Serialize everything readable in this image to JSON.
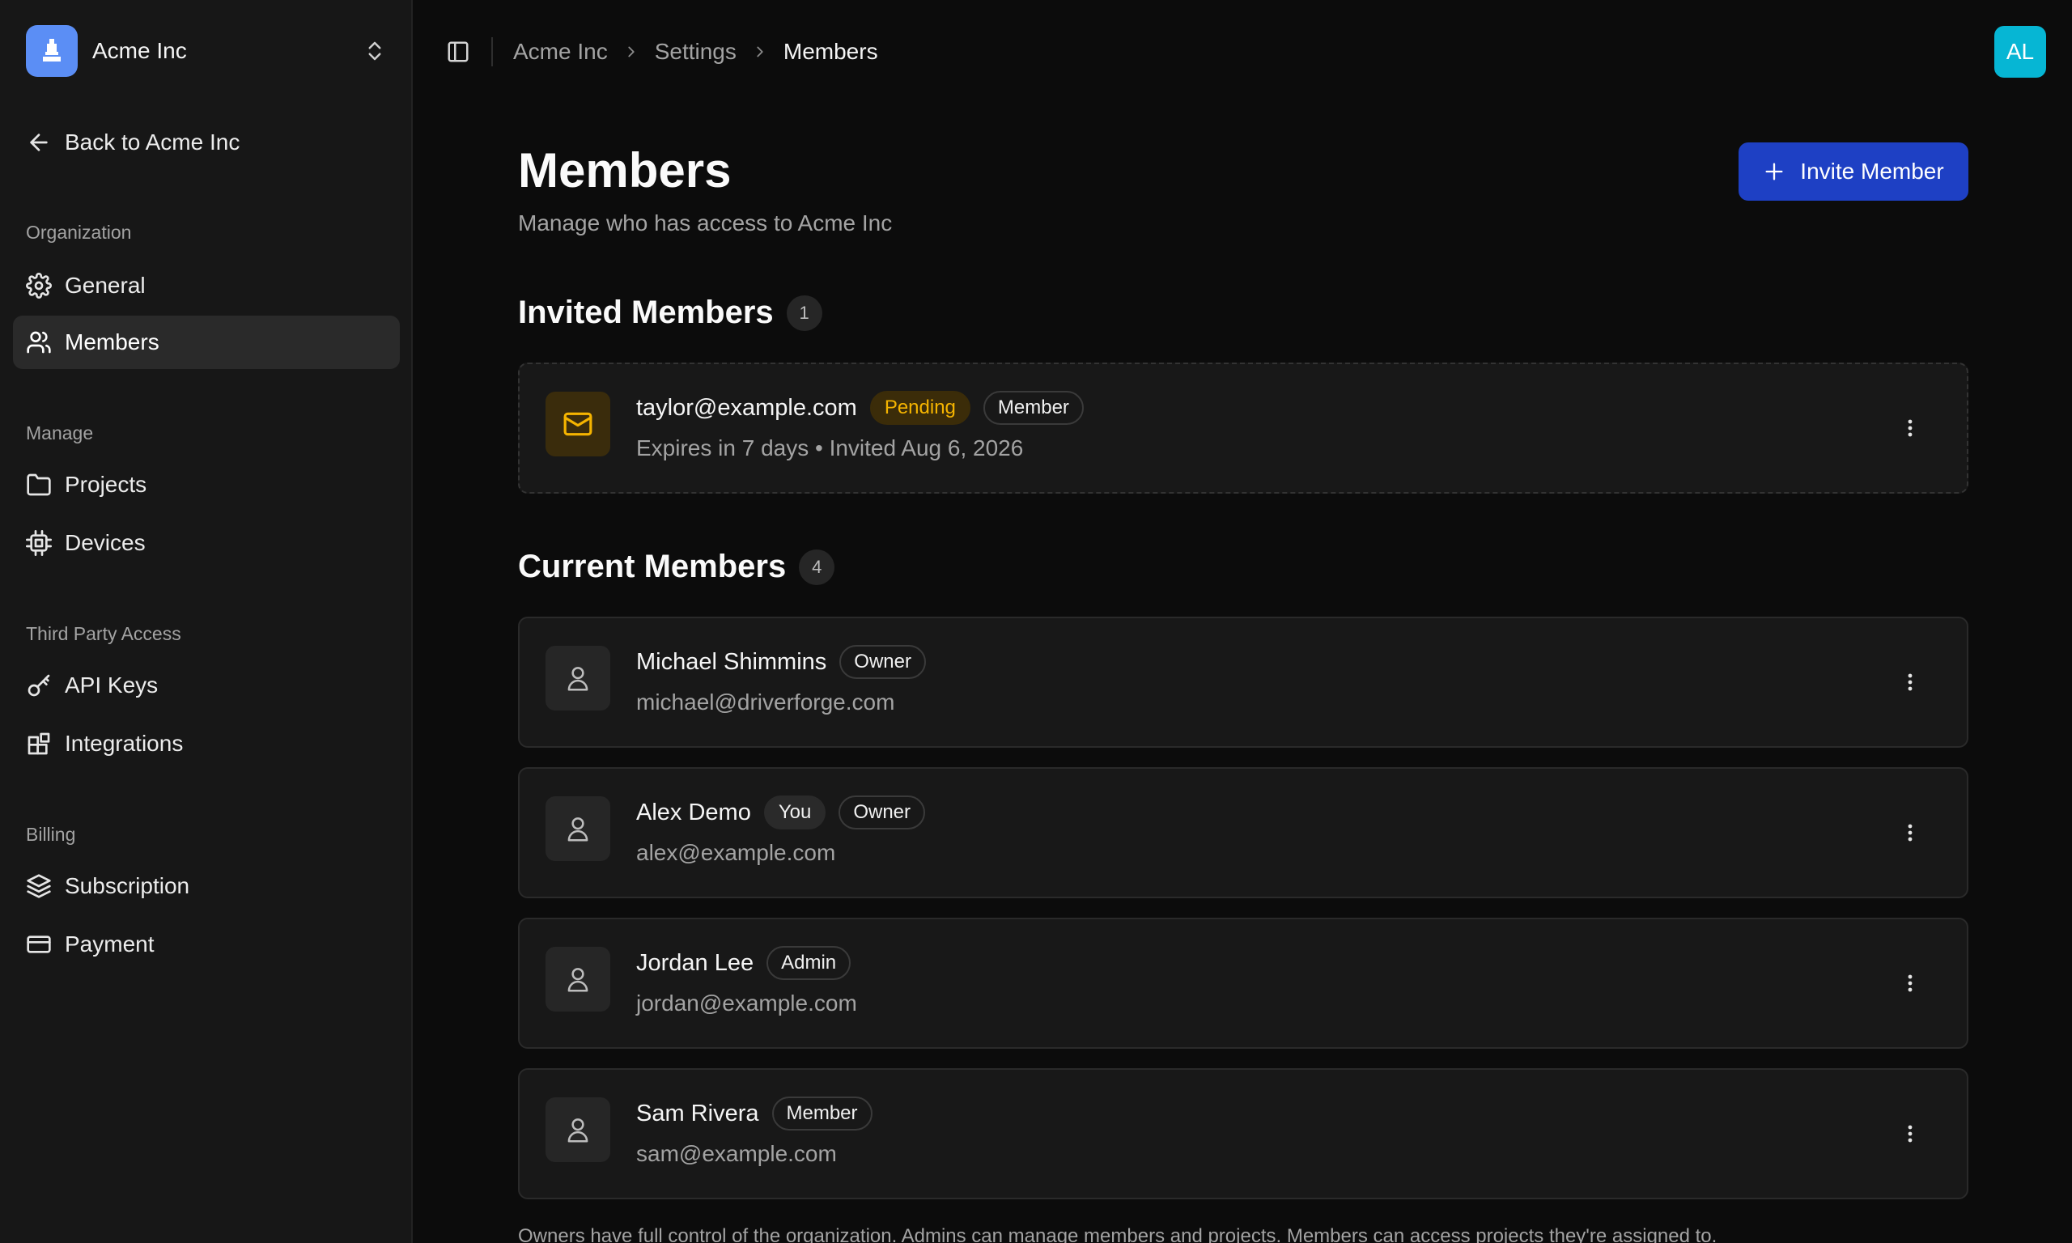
{
  "org": {
    "name": "Acme Inc",
    "logo_color": "#5b8ef5"
  },
  "sidebar": {
    "back_label": "Back to Acme Inc",
    "sections": {
      "organization": "Organization",
      "manage": "Manage",
      "third_party": "Third Party Access",
      "billing": "Billing"
    },
    "items": {
      "general": {
        "label": "General",
        "icon": "gear-icon"
      },
      "members": {
        "label": "Members",
        "icon": "users-icon",
        "active": true
      },
      "projects": {
        "label": "Projects",
        "icon": "folder-icon"
      },
      "devices": {
        "label": "Devices",
        "icon": "chip-icon"
      },
      "api_keys": {
        "label": "API Keys",
        "icon": "key-icon"
      },
      "integrations": {
        "label": "Integrations",
        "icon": "blocks-icon"
      },
      "subscription": {
        "label": "Subscription",
        "icon": "layers-icon"
      },
      "payment": {
        "label": "Payment",
        "icon": "credit-card-icon"
      }
    }
  },
  "topbar": {
    "breadcrumb": [
      "Acme Inc",
      "Settings",
      "Members"
    ],
    "avatar_initials": "AL",
    "avatar_color": "#06b6d4"
  },
  "page": {
    "title": "Members",
    "subtitle": "Manage who has access to Acme Inc",
    "invite_label": "Invite Member",
    "accent_color": "#1e40c4"
  },
  "invited": {
    "heading": "Invited Members",
    "count": "1",
    "items": [
      {
        "email": "taylor@example.com",
        "status": "Pending",
        "role": "Member",
        "detail": "Expires in 7 days • Invited Aug 6, 2026"
      }
    ]
  },
  "current": {
    "heading": "Current Members",
    "count": "4",
    "items": [
      {
        "name": "Michael Shimmins",
        "badges": [
          "Owner"
        ],
        "email": "michael@driverforge.com"
      },
      {
        "name": "Alex Demo",
        "badges": [
          "You",
          "Owner"
        ],
        "email": "alex@example.com"
      },
      {
        "name": "Jordan Lee",
        "badges": [
          "Admin"
        ],
        "email": "jordan@example.com"
      },
      {
        "name": "Sam Rivera",
        "badges": [
          "Member"
        ],
        "email": "sam@example.com"
      }
    ]
  },
  "footnote": "Owners have full control of the organization. Admins can manage members and projects. Members can access projects they're assigned to."
}
